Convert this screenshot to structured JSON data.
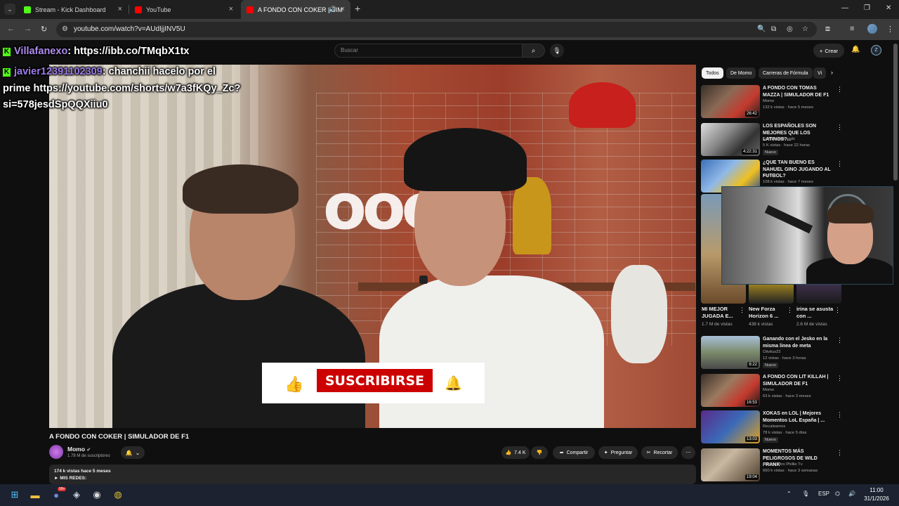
{
  "browser": {
    "tabs": [
      {
        "title": "Stream - Kick Dashboard",
        "favicon_color": "#53fc18"
      },
      {
        "title": "YouTube",
        "favicon_color": "#ff0000"
      },
      {
        "title": "A FONDO CON COKER | SIM",
        "favicon_color": "#ff0000"
      }
    ],
    "url": "youtube.com/watch?v=AUdIjjINV5U"
  },
  "youtube": {
    "search_placeholder": "Buscar",
    "create_label": "Crear",
    "avatar_letter": "Z"
  },
  "chat": {
    "messages": [
      {
        "user": "Villafanexo",
        "text": ": https://ibb.co/TMqbX1tx"
      },
      {
        "user": "javier12391102309",
        "text": ": chanchii hacelo por el"
      }
    ],
    "wrap_line_1": "prime https://youtube.com/shorts/w7a3fKQy_Zc?",
    "wrap_line_2": "si=578jesdSpQQXiiu0"
  },
  "video": {
    "subscribe_label": "SUSCRIBIRSE",
    "title": "A FONDO CON COKER | SIMULADOR DE F1",
    "channel": "Momo",
    "subscribers": "1.78 M de suscriptores",
    "likes": "7.4 K",
    "share_label": "Compartir",
    "ask_label": "Preguntar",
    "clip_label": "Recortar",
    "views_date": "174 k vistas  hace 5 meses",
    "desc_line": "► MIS REDES:"
  },
  "sidebar": {
    "chips": [
      "Todos",
      "De Momo",
      "Carreras de Fórmula",
      "Vi"
    ],
    "recs": [
      {
        "title": "A FONDO CON TOMAS MAZZA | SIMULADOR DE F1",
        "channel": "Momo",
        "meta": "132 k vistas · hace 5 meses",
        "duration": "26:42",
        "badge": ""
      },
      {
        "title": "LOS ESPAÑOLES SON MEJORES QUE LOS LATINOS?...",
        "channel": "Goncho kick vods",
        "meta": "5 K vistas · hace 22 horas",
        "duration": "4:22:31",
        "badge": "Nuevo"
      },
      {
        "title": "¿QUE TAN BUENO ES NAHUEL GINO JUGANDO AL FUTBOL?",
        "channel": "Tonali",
        "meta": "108 k vistas · hace 7 meses",
        "duration": "",
        "badge": ""
      },
      {
        "title": "Ganando con el Jesko en la misma linea de meta",
        "channel": "Olivitus22",
        "meta": "12 vistas · hace 3 horas",
        "duration": "8:22",
        "badge": "Nuevo"
      },
      {
        "title": "A FONDO CON LIT KILLAH | SIMULADOR DE F1",
        "channel": "Momo",
        "meta": "63 k vistas · hace 3 meses",
        "duration": "16:53",
        "badge": ""
      },
      {
        "title": "XOKAS en LOL | Mejores Momentos LoL España | ...",
        "channel": "Recaleamos",
        "meta": "78 k vistas · hace 5 días",
        "duration": "13:03",
        "badge": "Nuevo"
      },
      {
        "title": "MOMENTOS MÁS PELIGROSOS DE WILD FRANK",
        "channel": "Prende Otro Phillie Tv",
        "meta": "660 k vistas · hace 3 semanas",
        "duration": "19:04",
        "badge": ""
      }
    ],
    "shorts": [
      {
        "title": "MI MEJOR JUGADA E...",
        "views": "1.7 M de vistas"
      },
      {
        "title": "New Forza Horizon 6 ...",
        "views": "438 k vistas"
      },
      {
        "title": "irina se asusta con ...",
        "views": "2.6 M de vistas"
      }
    ]
  },
  "taskbar": {
    "lang": "ESP",
    "time": "11:00",
    "date": "31/1/2026",
    "discord_badge": "99+"
  }
}
